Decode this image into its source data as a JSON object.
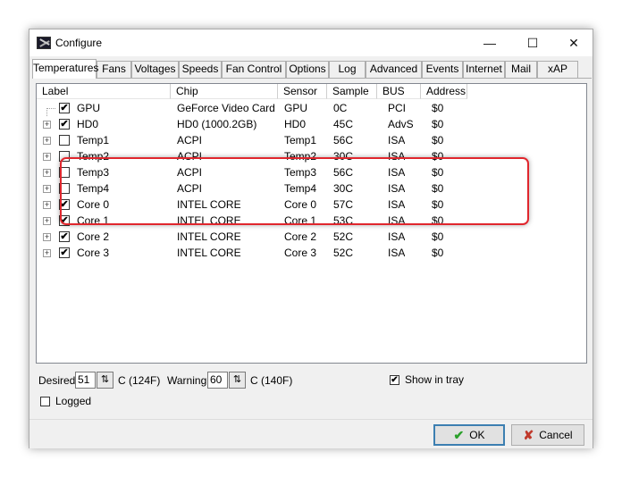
{
  "window": {
    "title": "Configure",
    "min_icon": "minimize-icon",
    "max_icon": "maximize-icon",
    "close_icon": "close-icon"
  },
  "tabs": [
    {
      "label": "Temperatures"
    },
    {
      "label": "Fans"
    },
    {
      "label": "Voltages"
    },
    {
      "label": "Speeds"
    },
    {
      "label": "Fan Control"
    },
    {
      "label": "Options"
    },
    {
      "label": "Log"
    },
    {
      "label": "Advanced"
    },
    {
      "label": "Events"
    },
    {
      "label": "Internet"
    },
    {
      "label": "Mail"
    },
    {
      "label": "xAP"
    }
  ],
  "active_tab": "Temperatures",
  "columns": [
    "Label",
    "Chip",
    "Sensor",
    "Sample",
    "BUS",
    "Address"
  ],
  "rows": [
    {
      "checked": true,
      "label": "GPU",
      "chip": "GeForce Video Card",
      "sensor": "GPU",
      "sample": "0C",
      "bus": "PCI",
      "address": "$0"
    },
    {
      "checked": true,
      "label": "HD0",
      "chip": "HD0 (1000.2GB)",
      "sensor": "HD0",
      "sample": "45C",
      "bus": "AdvS",
      "address": "$0"
    },
    {
      "checked": false,
      "label": "Temp1",
      "chip": "ACPI",
      "sensor": "Temp1",
      "sample": "56C",
      "bus": "ISA",
      "address": "$0"
    },
    {
      "checked": false,
      "label": "Temp2",
      "chip": "ACPI",
      "sensor": "Temp2",
      "sample": "30C",
      "bus": "ISA",
      "address": "$0"
    },
    {
      "checked": false,
      "label": "Temp3",
      "chip": "ACPI",
      "sensor": "Temp3",
      "sample": "56C",
      "bus": "ISA",
      "address": "$0"
    },
    {
      "checked": false,
      "label": "Temp4",
      "chip": "ACPI",
      "sensor": "Temp4",
      "sample": "30C",
      "bus": "ISA",
      "address": "$0"
    },
    {
      "checked": true,
      "label": "Core 0",
      "chip": "INTEL CORE",
      "sensor": "Core 0",
      "sample": "57C",
      "bus": "ISA",
      "address": "$0"
    },
    {
      "checked": true,
      "label": "Core 1",
      "chip": "INTEL CORE",
      "sensor": "Core 1",
      "sample": "53C",
      "bus": "ISA",
      "address": "$0"
    },
    {
      "checked": true,
      "label": "Core 2",
      "chip": "INTEL CORE",
      "sensor": "Core 2",
      "sample": "52C",
      "bus": "ISA",
      "address": "$0"
    },
    {
      "checked": true,
      "label": "Core 3",
      "chip": "INTEL CORE",
      "sensor": "Core 3",
      "sample": "52C",
      "bus": "ISA",
      "address": "$0"
    }
  ],
  "settings": {
    "desired_label": "Desired",
    "desired_value": "51",
    "desired_unit": "C (124F)",
    "warning_label": "Warning",
    "warning_value": "60",
    "warning_unit": "C (140F)",
    "show_in_tray_label": "Show in tray",
    "show_in_tray_checked": true,
    "logged_label": "Logged",
    "logged_checked": false
  },
  "buttons": {
    "ok_label": "OK",
    "cancel_label": "Cancel",
    "ok_icon": "checkmark-icon",
    "cancel_icon": "x-icon"
  },
  "colors": {
    "highlight_border": "#e0262d",
    "ok_icon": "#2aa02a",
    "cancel_icon": "#c0392b"
  }
}
